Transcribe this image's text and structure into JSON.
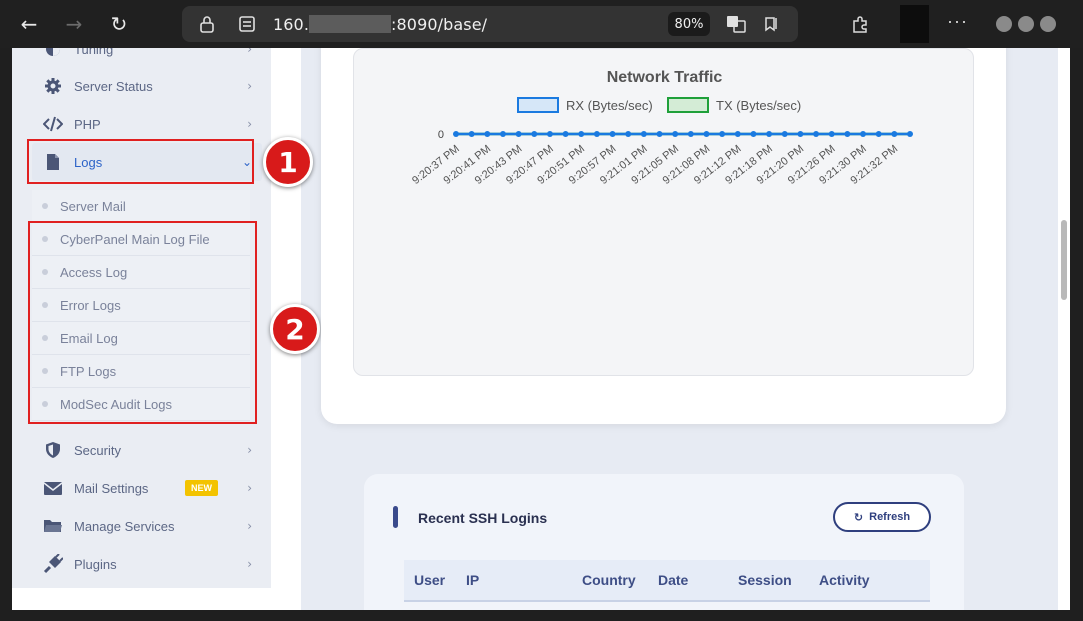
{
  "browser": {
    "url_prefix": "160.",
    "url_suffix": ":8090/base/",
    "zoom": "80%"
  },
  "sidebar": {
    "items": [
      {
        "label": "Tuning",
        "icon": "tuning-icon"
      },
      {
        "label": "Server Status",
        "icon": "gear-icon"
      },
      {
        "label": "PHP",
        "icon": "code-icon"
      },
      {
        "label": "Logs",
        "icon": "file-icon"
      },
      {
        "label": "Security",
        "icon": "shield-icon"
      },
      {
        "label": "Mail Settings",
        "icon": "mail-icon",
        "badge": "NEW"
      },
      {
        "label": "Manage Services",
        "icon": "folder-icon"
      },
      {
        "label": "Plugins",
        "icon": "plug-icon"
      }
    ],
    "log_submenu": [
      "Server Mail",
      "CyberPanel Main Log File",
      "Access Log",
      "Error Logs",
      "Email Log",
      "FTP Logs",
      "ModSec Audit Logs"
    ]
  },
  "annotations": {
    "callout_1": "1",
    "callout_2": "2"
  },
  "chart_data": {
    "type": "line",
    "title": "Network Traffic",
    "series": [
      {
        "name": "RX (Bytes/sec)",
        "color": "#1a7ae0",
        "values": [
          0,
          0,
          0,
          0,
          0,
          0,
          0,
          0,
          0,
          0,
          0,
          0,
          0,
          0,
          0,
          0,
          0,
          0,
          0,
          0,
          0,
          0,
          0,
          0,
          0,
          0,
          0,
          0,
          0,
          0
        ]
      },
      {
        "name": "TX (Bytes/sec)",
        "color": "#1fa03a",
        "values": [
          0,
          0,
          0,
          0,
          0,
          0,
          0,
          0,
          0,
          0,
          0,
          0,
          0,
          0,
          0,
          0,
          0,
          0,
          0,
          0,
          0,
          0,
          0,
          0,
          0,
          0,
          0,
          0,
          0,
          0
        ]
      }
    ],
    "y_tick": "0",
    "x_tick_labels": [
      "9:20:37 PM",
      "9:20:41 PM",
      "9:20:43 PM",
      "9:20:47 PM",
      "9:20:51 PM",
      "9:20:57 PM",
      "9:21:01 PM",
      "9:21:05 PM",
      "9:21:08 PM",
      "9:21:12 PM",
      "9:21:18 PM",
      "9:21:20 PM",
      "9:21:26 PM",
      "9:21:30 PM",
      "9:21:32 PM"
    ],
    "points": 30,
    "legend_position": "top"
  },
  "ssh": {
    "title": "Recent SSH Logins",
    "refresh_label": "Refresh",
    "columns": [
      "User",
      "IP",
      "Country",
      "Date",
      "Session",
      "Activity"
    ]
  }
}
